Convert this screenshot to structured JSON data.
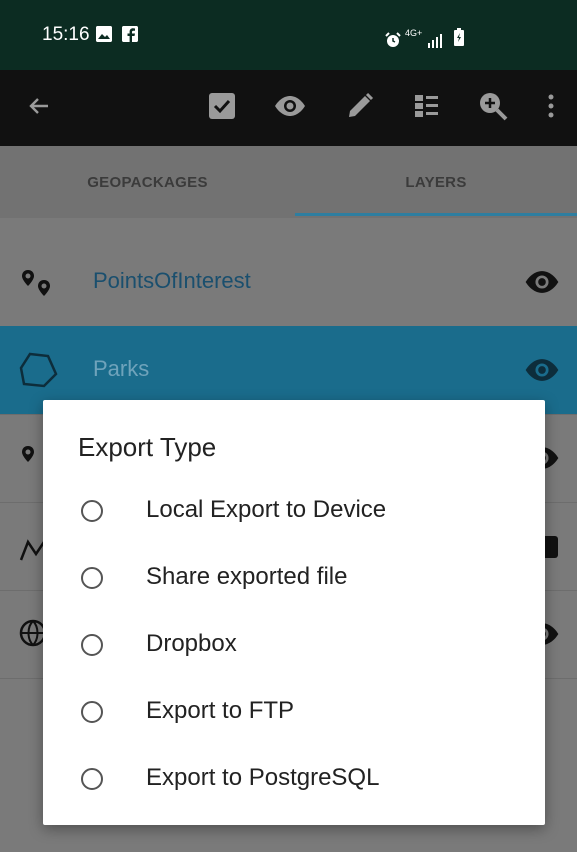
{
  "status_bar": {
    "time": "15:16",
    "network": "4G+",
    "icons": [
      "image-icon",
      "facebook-icon",
      "alarm-icon",
      "signal-icon",
      "battery-icon"
    ]
  },
  "toolbar": {
    "icons": [
      "back-arrow-icon",
      "checkbox-icon",
      "eye-icon",
      "pencil-icon",
      "list-view-icon",
      "zoom-in-icon",
      "more-vert-icon"
    ]
  },
  "tabs": [
    {
      "label": "GEOPACKAGES",
      "selected": false
    },
    {
      "label": "LAYERS",
      "selected": true
    }
  ],
  "layers": [
    {
      "name": "PointsOfInterest",
      "icon": "points-icon",
      "visible": true,
      "selected": false
    },
    {
      "name": "Parks",
      "icon": "polygon-icon",
      "visible": true,
      "selected": true
    },
    {
      "name": "",
      "icon": "point-icon",
      "visible": true,
      "selected": false
    },
    {
      "name": "",
      "icon": "line-icon",
      "visible": true,
      "selected": false
    },
    {
      "name": "",
      "icon": "globe-icon",
      "visible": true,
      "selected": false
    }
  ],
  "dialog": {
    "title": "Export Type",
    "options": [
      {
        "label": "Local Export to Device"
      },
      {
        "label": "Share exported file"
      },
      {
        "label": "Dropbox"
      },
      {
        "label": "Export to FTP"
      },
      {
        "label": "Export to PostgreSQL"
      }
    ]
  },
  "colors": {
    "status_bar": "#0c2c22",
    "toolbar": "#111111",
    "accent": "#c2185b",
    "tab_indicator": "#2e7ea0",
    "selected_row": "#1a6c8c",
    "scrim": "#7a7a7a"
  }
}
